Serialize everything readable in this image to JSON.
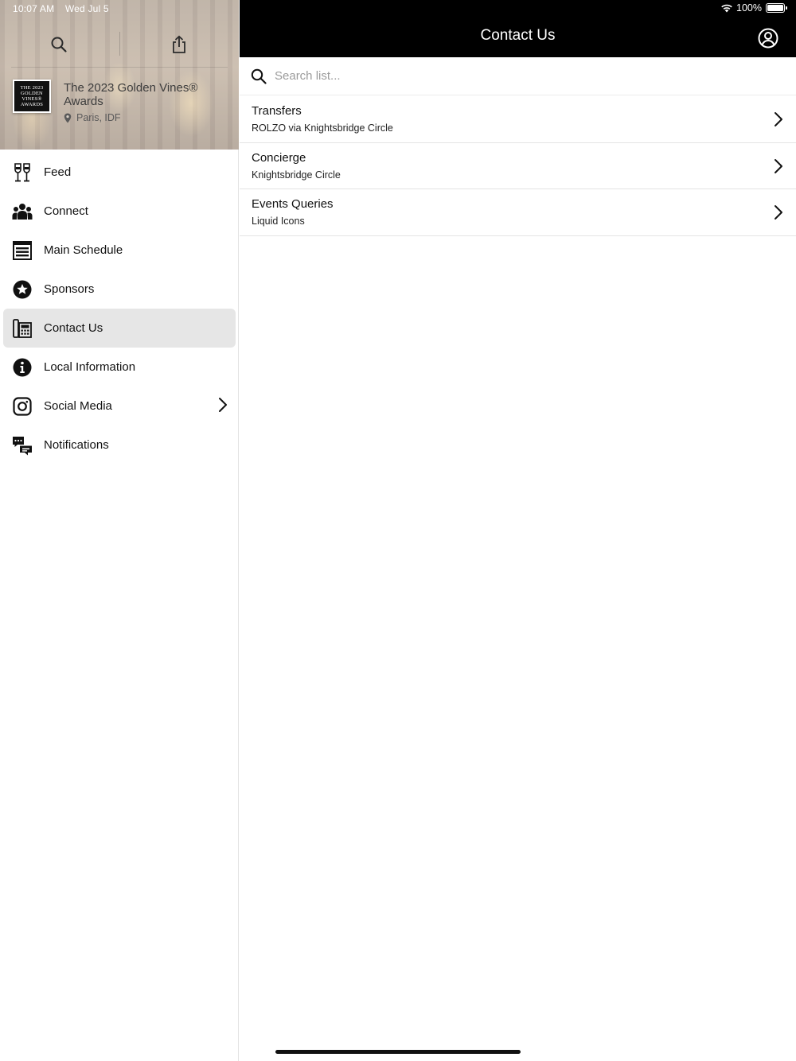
{
  "status": {
    "time": "10:07 AM",
    "date": "Wed Jul 5",
    "battery_percent": "100%",
    "battery_level": 1.0
  },
  "sidebar": {
    "event": {
      "logo_lines": [
        "THE 2023",
        "GOLDEN",
        "VINES®",
        "AWARDS"
      ],
      "title": "The 2023 Golden Vines® Awards",
      "location": "Paris, IDF"
    },
    "items": [
      {
        "label": "Feed",
        "icon": "wine-glasses-icon",
        "active": false
      },
      {
        "label": "Connect",
        "icon": "people-group-icon",
        "active": false
      },
      {
        "label": "Main Schedule",
        "icon": "schedule-list-icon",
        "active": false
      },
      {
        "label": "Sponsors",
        "icon": "star-badge-icon",
        "active": false
      },
      {
        "label": "Contact Us",
        "icon": "office-phone-icon",
        "active": true
      },
      {
        "label": "Local Information",
        "icon": "info-circle-icon",
        "active": false
      },
      {
        "label": "Social Media",
        "icon": "instagram-icon",
        "active": false,
        "has_submenu": true
      },
      {
        "label": "Notifications",
        "icon": "chat-bubbles-icon",
        "active": false
      }
    ]
  },
  "main": {
    "title": "Contact Us",
    "search": {
      "placeholder": "Search list...",
      "value": ""
    },
    "contacts": [
      {
        "title": "Transfers",
        "subtitle": "ROLZO via Knightsbridge Circle"
      },
      {
        "title": "Concierge",
        "subtitle": "Knightsbridge Circle"
      },
      {
        "title": "Events Queries",
        "subtitle": "Liquid Icons"
      }
    ]
  },
  "colors": {
    "topbar": "#000000",
    "active_item_bg": "#e6e6e6",
    "text": "#111111"
  }
}
